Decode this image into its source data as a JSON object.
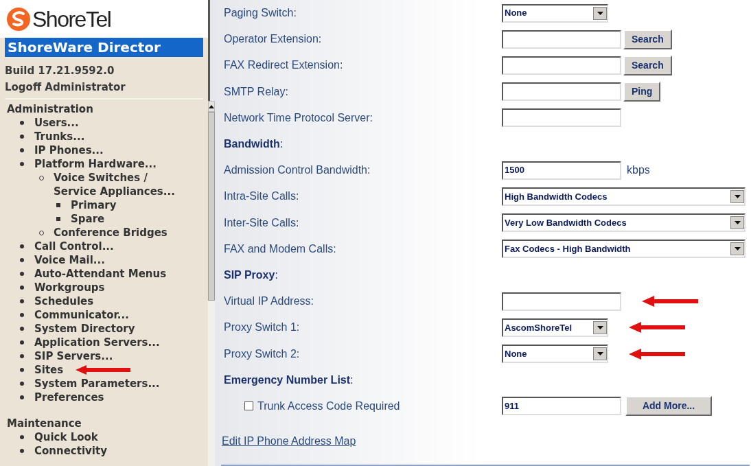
{
  "logo": {
    "text": "ShoreTel"
  },
  "banner": {
    "title": "ShoreWare Director"
  },
  "session": {
    "build": "Build 17.21.9592.0",
    "logoff": "Logoff Administrator"
  },
  "nav": [
    {
      "title": "Administration",
      "items": [
        {
          "label": "Users...",
          "annotated": false
        },
        {
          "label": "Trunks...",
          "annotated": false
        },
        {
          "label": "IP Phones...",
          "annotated": false
        },
        {
          "label": "Platform Hardware...",
          "annotated": false,
          "children": [
            {
              "label": "Voice Switches / Service Appliances...",
              "annotated": false,
              "children": [
                {
                  "label": "Primary",
                  "annotated": false
                },
                {
                  "label": "Spare",
                  "annotated": false
                }
              ]
            },
            {
              "label": "Conference Bridges",
              "annotated": false
            }
          ]
        },
        {
          "label": "Call Control...",
          "annotated": false
        },
        {
          "label": "Voice Mail...",
          "annotated": false
        },
        {
          "label": "Auto-Attendant Menus",
          "annotated": false
        },
        {
          "label": "Workgroups",
          "annotated": false
        },
        {
          "label": "Schedules",
          "annotated": false
        },
        {
          "label": "Communicator...",
          "annotated": false
        },
        {
          "label": "System Directory",
          "annotated": false
        },
        {
          "label": "Application Servers...",
          "annotated": false
        },
        {
          "label": "SIP Servers...",
          "annotated": false
        },
        {
          "label": "Sites",
          "annotated": true
        },
        {
          "label": "System Parameters...",
          "annotated": false
        },
        {
          "label": "Preferences",
          "annotated": false
        }
      ]
    },
    {
      "title": "Maintenance",
      "items": [
        {
          "label": "Quick Look",
          "annotated": false
        },
        {
          "label": "Connectivity",
          "annotated": false
        }
      ]
    }
  ],
  "form": [
    {
      "kind": "dropdown",
      "label": "Paging Switch:",
      "value": "None",
      "annotated": false
    },
    {
      "kind": "field-button",
      "label": "Operator Extension:",
      "button": "Search",
      "annotated": false
    },
    {
      "kind": "field-button",
      "label": "FAX Redirect Extension:",
      "button": "Search",
      "annotated": false
    },
    {
      "kind": "field-button",
      "label": "SMTP Relay:",
      "button": "Ping",
      "annotated": false
    },
    {
      "kind": "field",
      "label": "Network Time Protocol Server:",
      "annotated": false
    },
    {
      "kind": "heading",
      "label": "**Bandwidth**:"
    },
    {
      "kind": "field-unit",
      "label": "Admission Control Bandwidth:",
      "value": "1500",
      "unit": "kbps",
      "annotated": false
    },
    {
      "kind": "wide-dropdown",
      "label": "Intra-Site Calls:",
      "value": "High Bandwidth Codecs",
      "annotated": false
    },
    {
      "kind": "wide-dropdown",
      "label": "Inter-Site Calls:",
      "value": "Very Low Bandwidth Codecs",
      "annotated": false
    },
    {
      "kind": "wide-dropdown",
      "label": "FAX and Modem Calls:",
      "value": "Fax Codecs - High Bandwidth",
      "annotated": false
    },
    {
      "kind": "heading",
      "label": "**SIP Proxy**:"
    },
    {
      "kind": "field",
      "label": "Virtual IP Address:",
      "annotated": true
    },
    {
      "kind": "dropdown",
      "label": "Proxy Switch 1:",
      "value": "AscomShoreTel",
      "annotated": true
    },
    {
      "kind": "dropdown",
      "label": "Proxy Switch 2:",
      "value": "None",
      "annotated": true
    },
    {
      "kind": "heading",
      "label": "**Emergency Number List**:"
    },
    {
      "kind": "checkbox-field-button",
      "label": "Trunk Access Code Required",
      "checked": false,
      "value": "911",
      "button": "Add More...",
      "annotated": false
    }
  ],
  "link": "Edit IP Phone Address Map"
}
